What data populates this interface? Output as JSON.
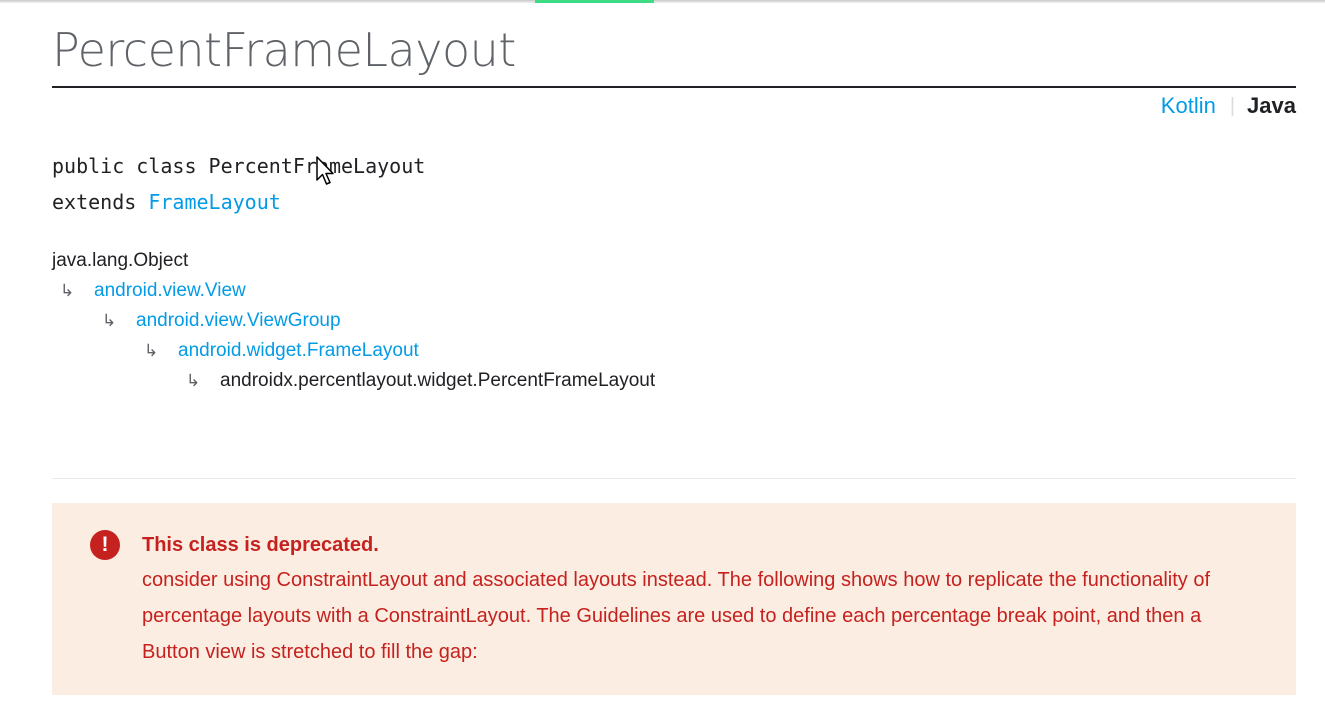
{
  "page": {
    "title": "PercentFrameLayout"
  },
  "language_switcher": {
    "kotlin_label": "Kotlin",
    "separator": "|",
    "java_label": "Java",
    "active": "Java"
  },
  "signature": {
    "line1": "public class PercentFrameLayout",
    "extends_keyword": "extends ",
    "extends_link": "FrameLayout"
  },
  "hierarchy": {
    "arrow_glyph": "↳",
    "items": [
      {
        "label": "java.lang.Object",
        "is_link": false
      },
      {
        "label": "android.view.View",
        "is_link": true
      },
      {
        "label": "android.view.ViewGroup",
        "is_link": true
      },
      {
        "label": "android.widget.FrameLayout",
        "is_link": true
      },
      {
        "label": "androidx.percentlayout.widget.PercentFrameLayout",
        "is_link": false
      }
    ]
  },
  "deprecation": {
    "icon": "error-icon",
    "icon_glyph": "!",
    "title": "This class is deprecated.",
    "body": "consider using ConstraintLayout and associated layouts instead. The following shows how to replicate the functionality of percentage layouts with a ConstraintLayout. The Guidelines are used to define each percentage break point, and then a Button view is stretched to fill the gap:"
  },
  "colors": {
    "link": "#039be5",
    "title": "#5f6368",
    "deprecation_bg": "#fcede2",
    "deprecation_text": "#c5221f",
    "progress_accent": "#3ddc84"
  }
}
